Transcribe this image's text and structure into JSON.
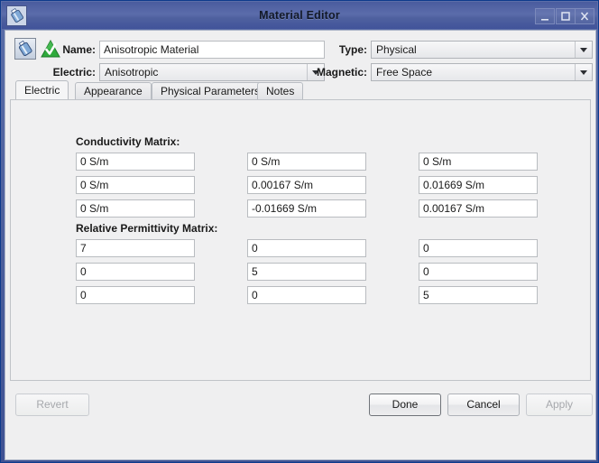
{
  "window": {
    "title": "Material Editor",
    "app_icon": "material-bottle-icon",
    "controls": {
      "minimize": "minimize-icon",
      "maximize": "maximize-icon",
      "close": "close-icon"
    }
  },
  "header": {
    "icons": [
      "material-bottle-icon",
      "green-triangle-check-icon"
    ],
    "name_label": "Name:",
    "name_value": "Anisotropic Material",
    "electric_label": "Electric:",
    "electric_value": "Anisotropic",
    "type_label": "Type:",
    "type_value": "Physical",
    "magnetic_label": "Magnetic:",
    "magnetic_value": "Free Space"
  },
  "tabs": [
    {
      "label": "Electric",
      "active": true
    },
    {
      "label": "Appearance",
      "active": false
    },
    {
      "label": "Physical Parameters",
      "active": false
    },
    {
      "label": "Notes",
      "active": false
    }
  ],
  "electric_tab": {
    "conductivity": {
      "title": "Conductivity Matrix:",
      "rows": [
        [
          "0 S/m",
          "0 S/m",
          "0 S/m"
        ],
        [
          "0 S/m",
          "0.00167 S/m",
          "0.01669 S/m"
        ],
        [
          "0 S/m",
          "-0.01669 S/m",
          "0.00167 S/m"
        ]
      ]
    },
    "permittivity": {
      "title": "Relative Permittivity Matrix:",
      "rows": [
        [
          "7",
          "0",
          "0"
        ],
        [
          "0",
          "5",
          "0"
        ],
        [
          "0",
          "0",
          "5"
        ]
      ]
    }
  },
  "buttons": {
    "revert": "Revert",
    "done": "Done",
    "cancel": "Cancel",
    "apply": "Apply"
  }
}
